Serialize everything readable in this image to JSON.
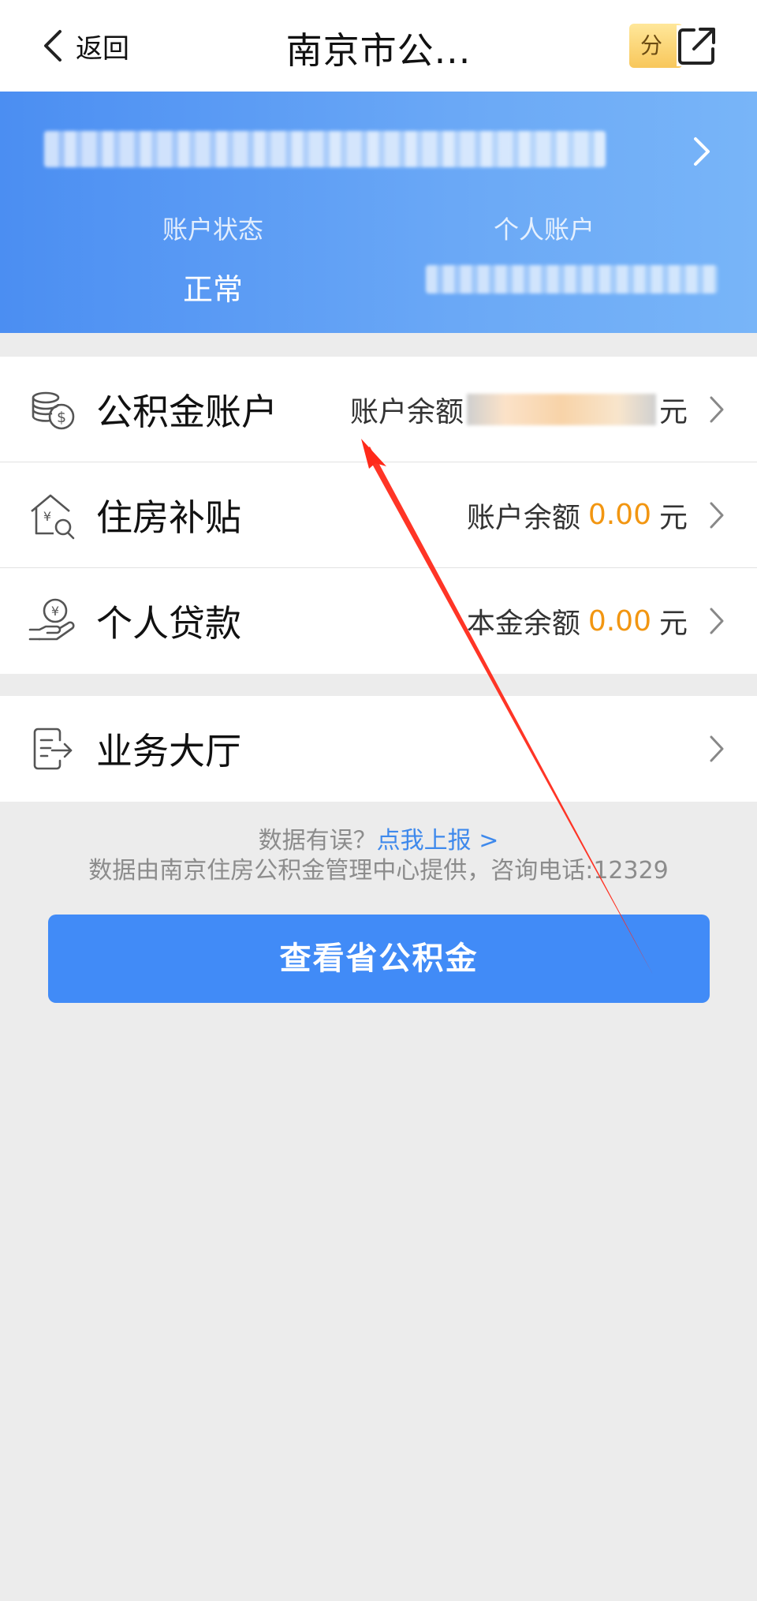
{
  "nav": {
    "back_label": "返回",
    "title": "南京市公...",
    "share_label": "分享"
  },
  "banner": {
    "account_status_label": "账户状态",
    "account_status_value": "正常",
    "personal_account_label": "个人账户"
  },
  "rows": [
    {
      "title": "公积金账户",
      "right_label": "账户余额",
      "unit": "元",
      "icon": "coins-icon"
    },
    {
      "title": "住房补贴",
      "right_label": "账户余额",
      "amount": "0.00",
      "unit": "元",
      "icon": "house-search-icon"
    },
    {
      "title": "个人贷款",
      "right_label": "本金余额",
      "amount": "0.00",
      "unit": "元",
      "icon": "hand-yen-icon"
    },
    {
      "title": "业务大厅",
      "icon": "document-export-icon"
    }
  ],
  "note": {
    "question": "数据有误？",
    "report_link": "点我上报 >",
    "source": "数据由南京住房公积金管理中心提供，咨询电话:12329"
  },
  "button": {
    "label": "查看省公积金"
  },
  "colors": {
    "primary": "#418bf7",
    "amount": "#f29611",
    "link": "#3e89ec",
    "annotation_arrow": "#ff2a1a"
  }
}
